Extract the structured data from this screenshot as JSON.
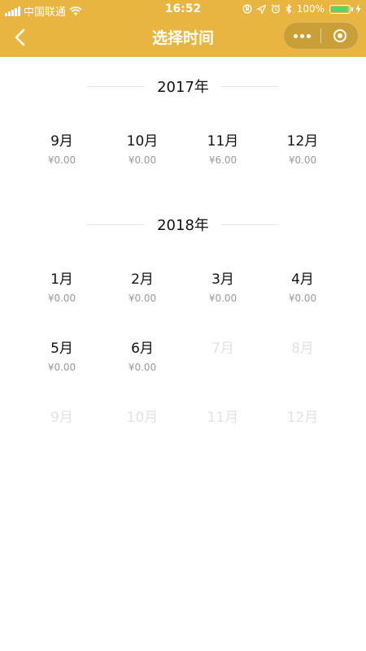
{
  "status_bar": {
    "carrier": "中国联通",
    "time": "16:52",
    "battery": "100%"
  },
  "nav": {
    "title": "选择时间"
  },
  "colors": {
    "header_bg": "#e8b540",
    "disabled_text": "#e2e2e2",
    "amount_text": "#999999"
  },
  "years": [
    {
      "year": "2017年",
      "months": [
        {
          "label": "9月",
          "amount": "¥0.00",
          "enabled": true
        },
        {
          "label": "10月",
          "amount": "¥0.00",
          "enabled": true
        },
        {
          "label": "11月",
          "amount": "¥6.00",
          "enabled": true
        },
        {
          "label": "12月",
          "amount": "¥0.00",
          "enabled": true
        }
      ]
    },
    {
      "year": "2018年",
      "months": [
        {
          "label": "1月",
          "amount": "¥0.00",
          "enabled": true
        },
        {
          "label": "2月",
          "amount": "¥0.00",
          "enabled": true
        },
        {
          "label": "3月",
          "amount": "¥0.00",
          "enabled": true
        },
        {
          "label": "4月",
          "amount": "¥0.00",
          "enabled": true
        },
        {
          "label": "5月",
          "amount": "¥0.00",
          "enabled": true
        },
        {
          "label": "6月",
          "amount": "¥0.00",
          "enabled": true
        },
        {
          "label": "7月",
          "enabled": false
        },
        {
          "label": "8月",
          "enabled": false
        },
        {
          "label": "9月",
          "enabled": false
        },
        {
          "label": "10月",
          "enabled": false
        },
        {
          "label": "11月",
          "enabled": false
        },
        {
          "label": "12月",
          "enabled": false
        }
      ]
    }
  ]
}
